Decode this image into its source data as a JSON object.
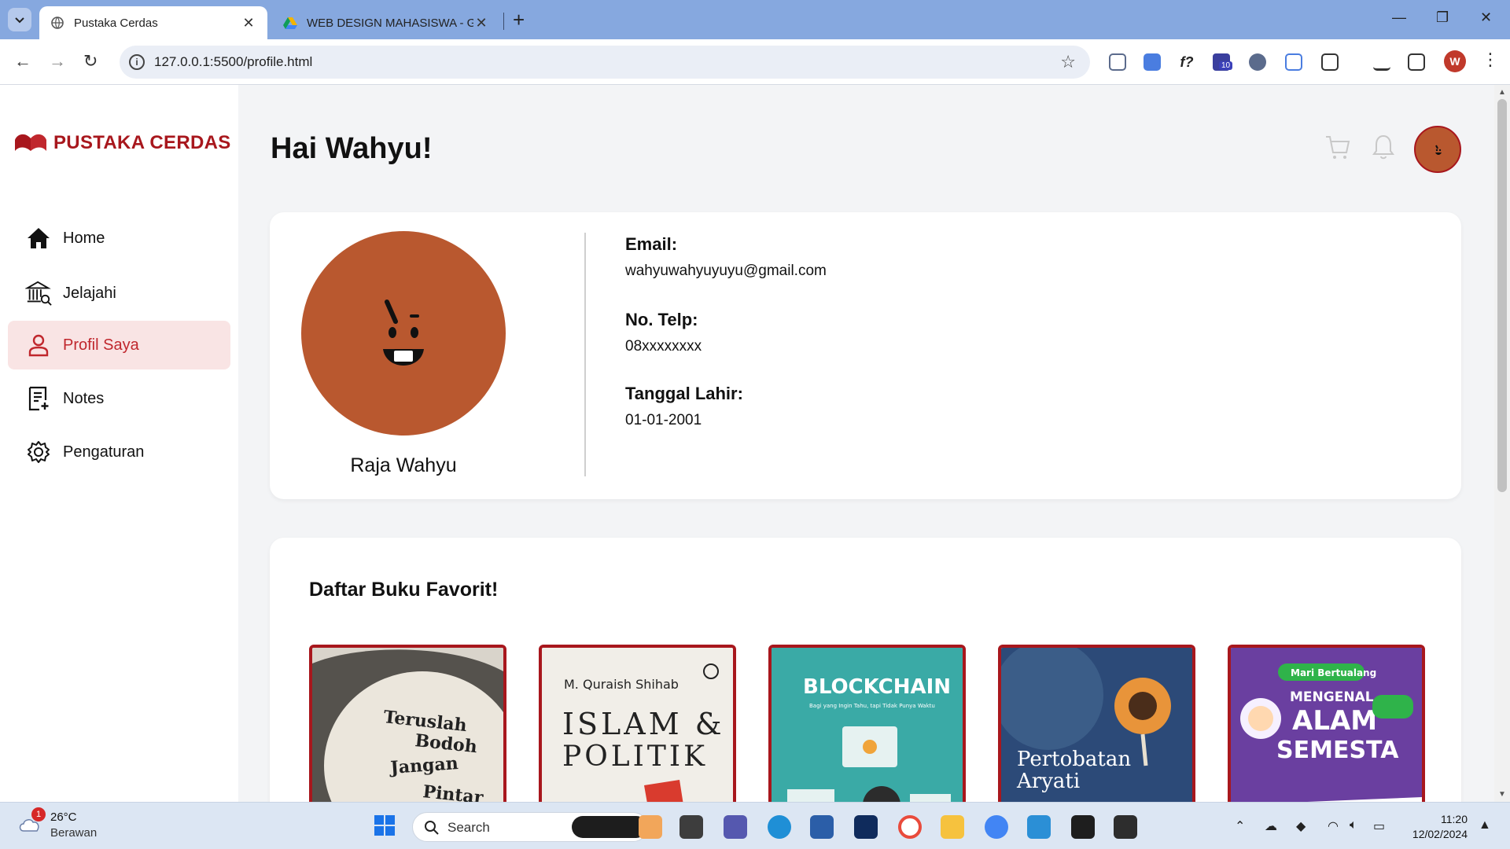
{
  "browser": {
    "tabs": [
      {
        "title": "Pustaka Cerdas",
        "active": true
      },
      {
        "title": "WEB DESIGN MAHASISWA - Go",
        "active": false
      }
    ],
    "url": "127.0.0.1:5500/profile.html",
    "profile_initial": "W",
    "extension_badge": "10"
  },
  "sidebar": {
    "logo_text": "PUSTAKA CERDAS",
    "items": [
      {
        "label": "Home",
        "icon": "home-icon",
        "active": false
      },
      {
        "label": "Jelajahi",
        "icon": "library-icon",
        "active": false
      },
      {
        "label": "Profil Saya",
        "icon": "user-icon",
        "active": true
      },
      {
        "label": "Notes",
        "icon": "notes-icon",
        "active": false
      },
      {
        "label": "Pengaturan",
        "icon": "gear-icon",
        "active": false
      }
    ]
  },
  "header": {
    "greeting": "Hai Wahyu!"
  },
  "profile": {
    "name": "Raja Wahyu",
    "email_label": "Email:",
    "email": "wahyuwahyuyuyu@gmail.com",
    "phone_label": "No. Telp:",
    "phone": "08xxxxxxxx",
    "dob_label": "Tanggal Lahir:",
    "dob": "01-01-2001"
  },
  "favorites": {
    "title": "Daftar Buku Favorit!",
    "books": [
      {
        "cover_lines": [
          "Teruslah",
          "Bodoh",
          "Jangan",
          "Pintar"
        ]
      },
      {
        "author": "M. Quraish Shihab",
        "title_lines": [
          "ISLAM &",
          "POLITIK"
        ]
      },
      {
        "title": "BLOCKCHAIN",
        "subtitle": "Bagi yang Ingin Tahu, tapi Tidak Punya Waktu"
      },
      {
        "title_lines": [
          "Pertobatan",
          "Aryati"
        ]
      },
      {
        "tag": "Mari Bertualang",
        "title_lines": [
          "MENGENAL",
          "ALAM",
          "SEMESTA"
        ]
      }
    ]
  },
  "taskbar": {
    "temperature": "26°C",
    "weather": "Berawan",
    "weather_badge": "1",
    "search_label": "Search",
    "time": "11:20",
    "date": "12/02/2024"
  },
  "colors": {
    "brand": "#a8171d",
    "active_bg": "#f9e4e4",
    "avatar": "#b9582f"
  }
}
